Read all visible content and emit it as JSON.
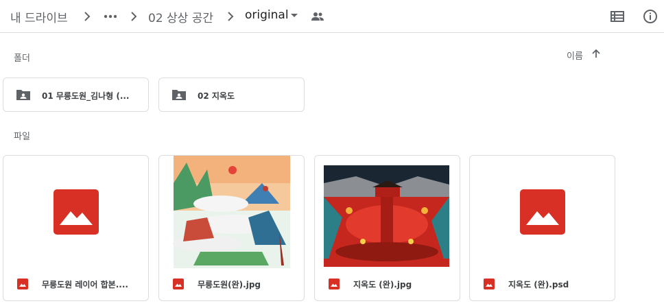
{
  "breadcrumb": {
    "root": "내 드라이브",
    "parent": "02 상상 공간",
    "current": "original"
  },
  "icons": {
    "more": "more-horiz-icon",
    "shared": "shared-people-icon",
    "list": "list-view-icon",
    "info": "info-icon"
  },
  "sections": {
    "folders_label": "폴더",
    "files_label": "파일",
    "sort_label": "이름"
  },
  "folders": [
    {
      "name": "01 무릉도원_김나형 (..."
    },
    {
      "name": "02 지옥도"
    }
  ],
  "files": [
    {
      "name": "무릉도원 레이어 합본....",
      "thumbnail": "placeholder"
    },
    {
      "name": "무릉도원(완).jpg",
      "thumbnail": "landscape-painting"
    },
    {
      "name": "지옥도 (완).jpg",
      "thumbnail": "hell-painting"
    },
    {
      "name": "지옥도 (완).psd",
      "thumbnail": "placeholder"
    }
  ],
  "colors": {
    "accent_red": "#d93025",
    "border": "#dadce0",
    "text_secondary": "#5f6368"
  }
}
